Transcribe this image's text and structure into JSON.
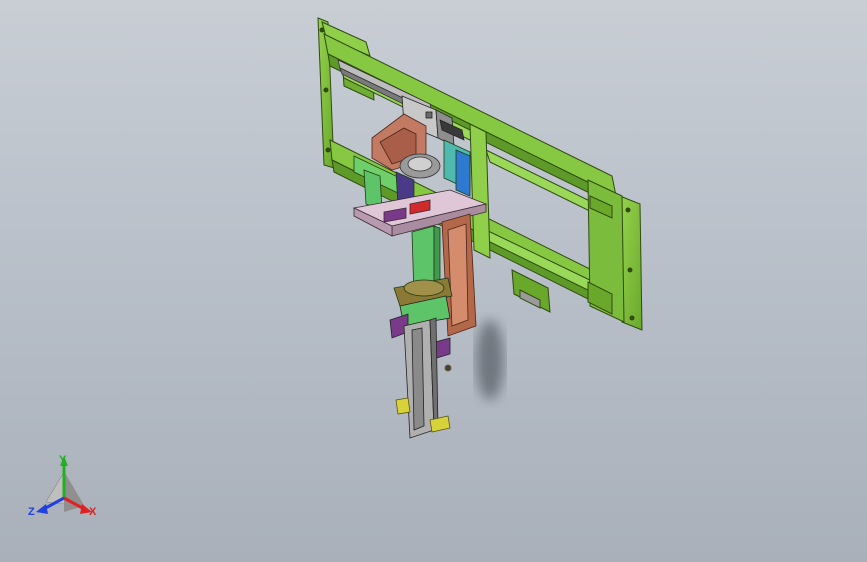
{
  "viewport": {
    "background_top": "#c9ced5",
    "background_bottom": "#a9b0ba"
  },
  "model": {
    "frame_color": "#7fc23a",
    "frame_edge_color": "#2f4a12",
    "bracket_color": "#b4684a",
    "plate_color": "#d9c3d2",
    "column_color": "#5ec46a",
    "rail_color": "#8e8e8e",
    "yellow_part_color": "#d8d23a"
  },
  "triad": {
    "x_label": "X",
    "y_label": "Y",
    "z_label": "Z",
    "x_color": "#e02020",
    "y_color": "#20b020",
    "z_color": "#2040e0"
  }
}
